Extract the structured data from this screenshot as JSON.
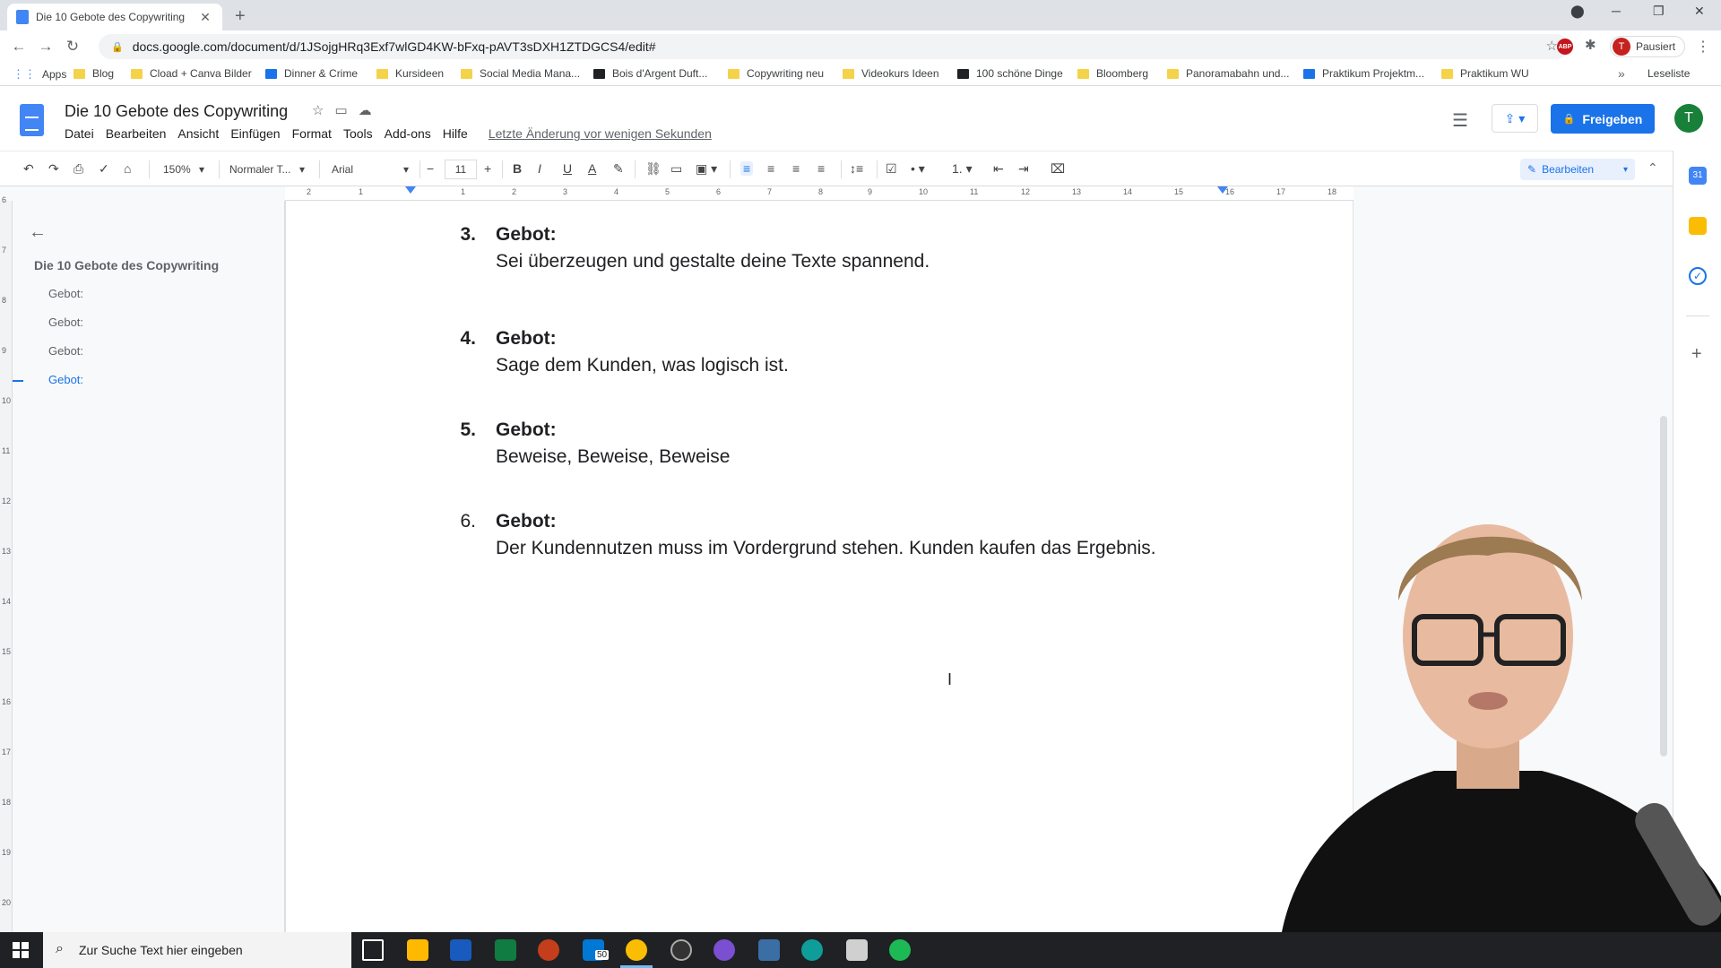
{
  "browser": {
    "tab_title": "Die 10 Gebote des Copywriting",
    "new_tab": "+",
    "url": "docs.google.com/document/d/1JSojgHRq3Exf7wlGD4KW-bFxq-pAVT3sDXH1ZTDGCS4/edit#",
    "profile_initial": "T",
    "profile_status": "Pausiert",
    "abp_label": "ABP"
  },
  "bookmarks": {
    "items": [
      "Apps",
      "Blog",
      "Cload + Canva Bilder",
      "Dinner & Crime",
      "Kursideen",
      "Social Media Mana...",
      "Bois d'Argent Duft...",
      "Copywriting neu",
      "Videokurs Ideen",
      "100 schöne Dinge",
      "Bloomberg",
      "Panoramabahn und...",
      "Praktikum Projektm...",
      "Praktikum WU"
    ],
    "more": "»",
    "reading_list": "Leseliste"
  },
  "docs": {
    "title": "Die 10 Gebote des Copywriting",
    "menu": [
      "Datei",
      "Bearbeiten",
      "Ansicht",
      "Einfügen",
      "Format",
      "Tools",
      "Add-ons",
      "Hilfe"
    ],
    "last_edit": "Letzte Änderung vor wenigen Sekunden",
    "share_label": "Freigeben",
    "user_initial": "T"
  },
  "format_toolbar": {
    "zoom": "150%",
    "style": "Normaler T...",
    "font": "Arial",
    "font_size": "11",
    "mode": "Bearbeiten"
  },
  "ruler": {
    "ticks": [
      "2",
      "1",
      "1",
      "2",
      "3",
      "4",
      "5",
      "6",
      "7",
      "8",
      "9",
      "10",
      "11",
      "12",
      "13",
      "14",
      "15",
      "16",
      "17",
      "18"
    ],
    "vticks": [
      "6",
      "7",
      "8",
      "9",
      "10",
      "11",
      "12",
      "13",
      "14",
      "15",
      "16",
      "17",
      "18",
      "19",
      "20"
    ]
  },
  "outline": {
    "title": "Die 10 Gebote des Copywriting",
    "items": [
      "Gebot:",
      "Gebot:",
      "Gebot:",
      "Gebot:"
    ],
    "selected_index": 3
  },
  "document": {
    "entries": [
      {
        "number": "3.",
        "heading": "Gebot:",
        "text": "Sei überzeugen und gestalte deine Texte spannend."
      },
      {
        "number": "4.",
        "heading": "Gebot:",
        "text": "Sage dem Kunden, was logisch ist."
      },
      {
        "number": "5.",
        "heading": "Gebot:",
        "text": "Beweise, Beweise, Beweise"
      },
      {
        "number": "6.",
        "heading": "Gebot:",
        "text": "Der Kundennutzen muss im Vordergrund stehen. Kunden kaufen das Ergebnis."
      }
    ]
  },
  "side_panel": {
    "calendar_label": "31"
  },
  "taskbar": {
    "search_placeholder": "Zur Suche Text hier eingeben",
    "mail_badge": "50"
  },
  "colors": {
    "accent": "#1a73e8",
    "share_button": "#1a73e8",
    "user_avatar": "#188038",
    "profile_avatar": "#c5221f"
  }
}
